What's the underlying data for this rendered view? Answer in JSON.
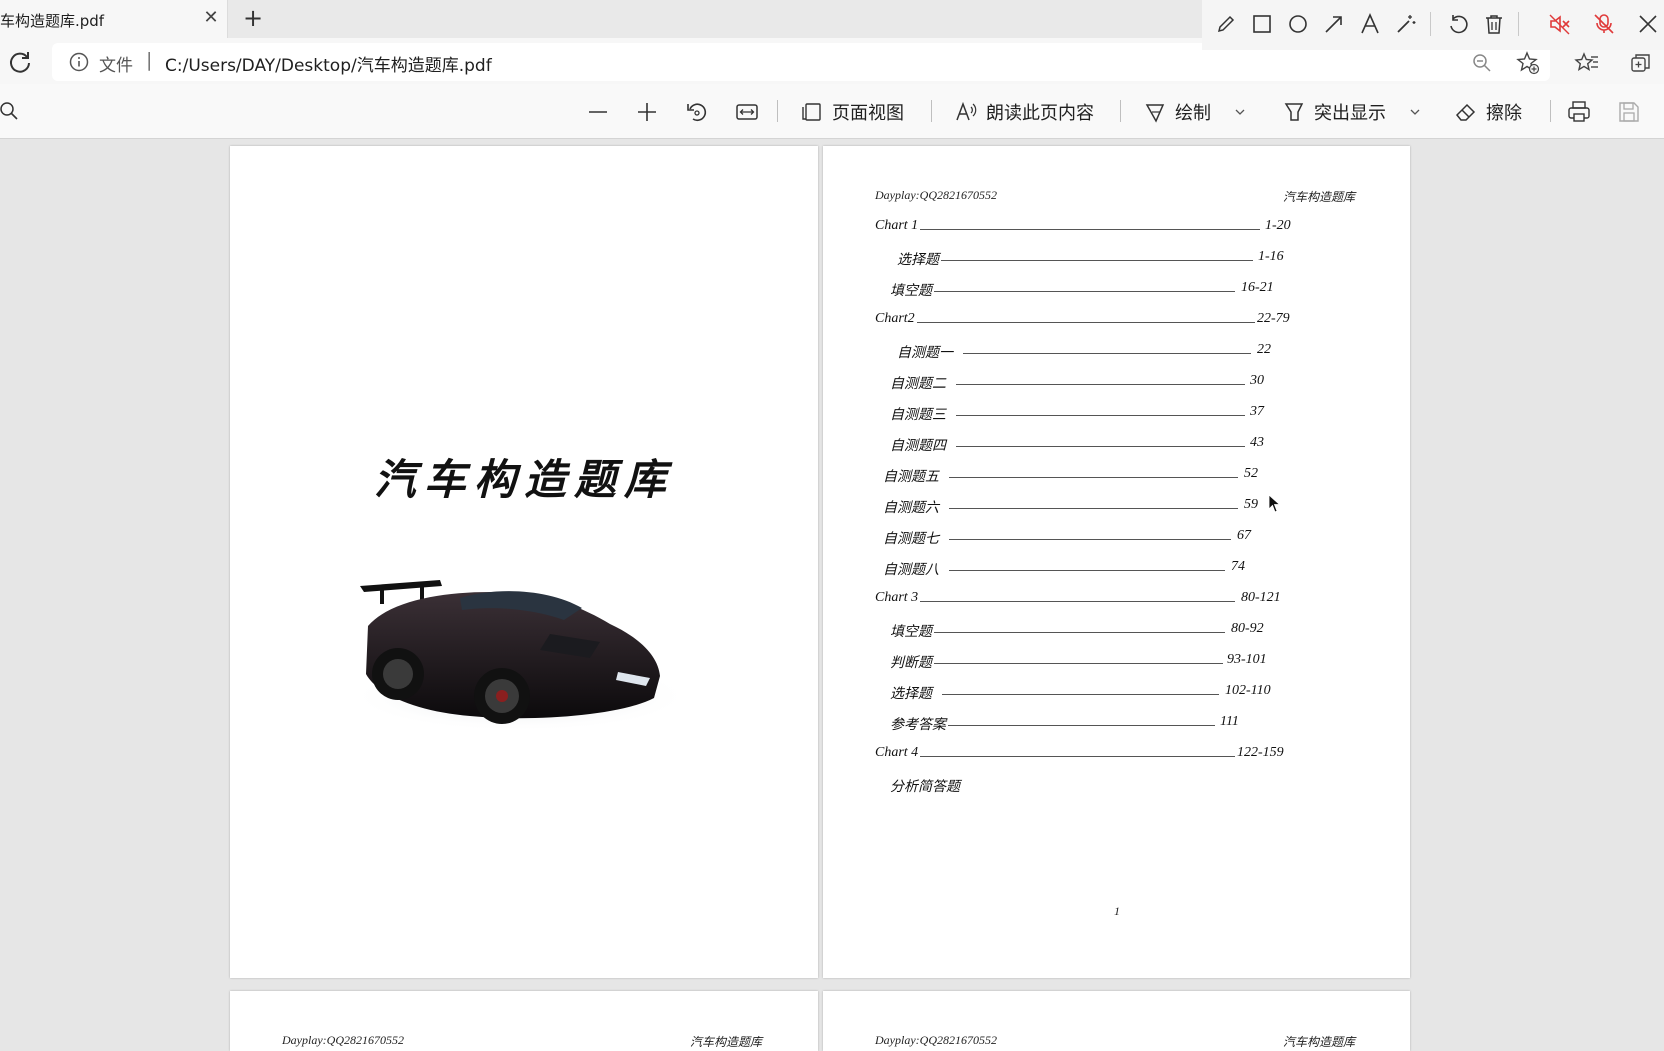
{
  "tab": {
    "title": "车构造题库.pdf",
    "close_glyph": "✕",
    "new_glyph": "+"
  },
  "address": {
    "label": "文件",
    "separator": "|",
    "url": "C:/Users/DAY/Desktop/汽车构造题库.pdf"
  },
  "annotation_toolbar": {
    "icons": [
      "pen-icon",
      "rectangle-icon",
      "circle-icon",
      "arrow-icon",
      "text-icon",
      "magic-wand-icon",
      "undo-icon",
      "delete-icon",
      "speaker-muted-icon",
      "mic-muted-icon",
      "close-icon"
    ],
    "muted_color": "#e03a3a"
  },
  "toolbar": {
    "page_view": "页面视图",
    "read_aloud": "朗读此页内容",
    "draw": "绘制",
    "highlight": "突出显示",
    "erase": "擦除"
  },
  "cover": {
    "title": "汽车构造题库"
  },
  "toc_page": {
    "header_left": "Dayplay:QQ2821670552",
    "header_right": "汽车构造题库",
    "entries": [
      {
        "label": "Chart 1",
        "pages": "1-20"
      },
      {
        "label": "选择题",
        "pages": "1-16"
      },
      {
        "label": "填空题",
        "pages": "16-21"
      },
      {
        "label": "Chart2",
        "pages": "22-79"
      },
      {
        "label": "自测题一",
        "pages": "22"
      },
      {
        "label": "自测题二",
        "pages": "30"
      },
      {
        "label": "自测题三",
        "pages": "37"
      },
      {
        "label": "自测题四",
        "pages": "43"
      },
      {
        "label": "自测题五",
        "pages": "52"
      },
      {
        "label": "自测题六",
        "pages": "59"
      },
      {
        "label": "自测题七",
        "pages": "67"
      },
      {
        "label": "自测题八",
        "pages": "74"
      },
      {
        "label": "Chart 3",
        "pages": "80-121"
      },
      {
        "label": "填空题",
        "pages": "80-92"
      },
      {
        "label": "判断题",
        "pages": "93-101"
      },
      {
        "label": "选择题",
        "pages": "102-110"
      },
      {
        "label": "参考答案",
        "pages": "111"
      },
      {
        "label": "Chart 4",
        "pages": "122-159"
      },
      {
        "label": "分析简答题",
        "pages": ""
      }
    ],
    "page_number": "1"
  },
  "next_pages": {
    "left_header_left": "Dayplay:QQ2821670552",
    "left_header_right": "汽车构造题库",
    "right_header_left": "Dayplay:QQ2821670552",
    "right_header_right": "汽车构造题库"
  }
}
